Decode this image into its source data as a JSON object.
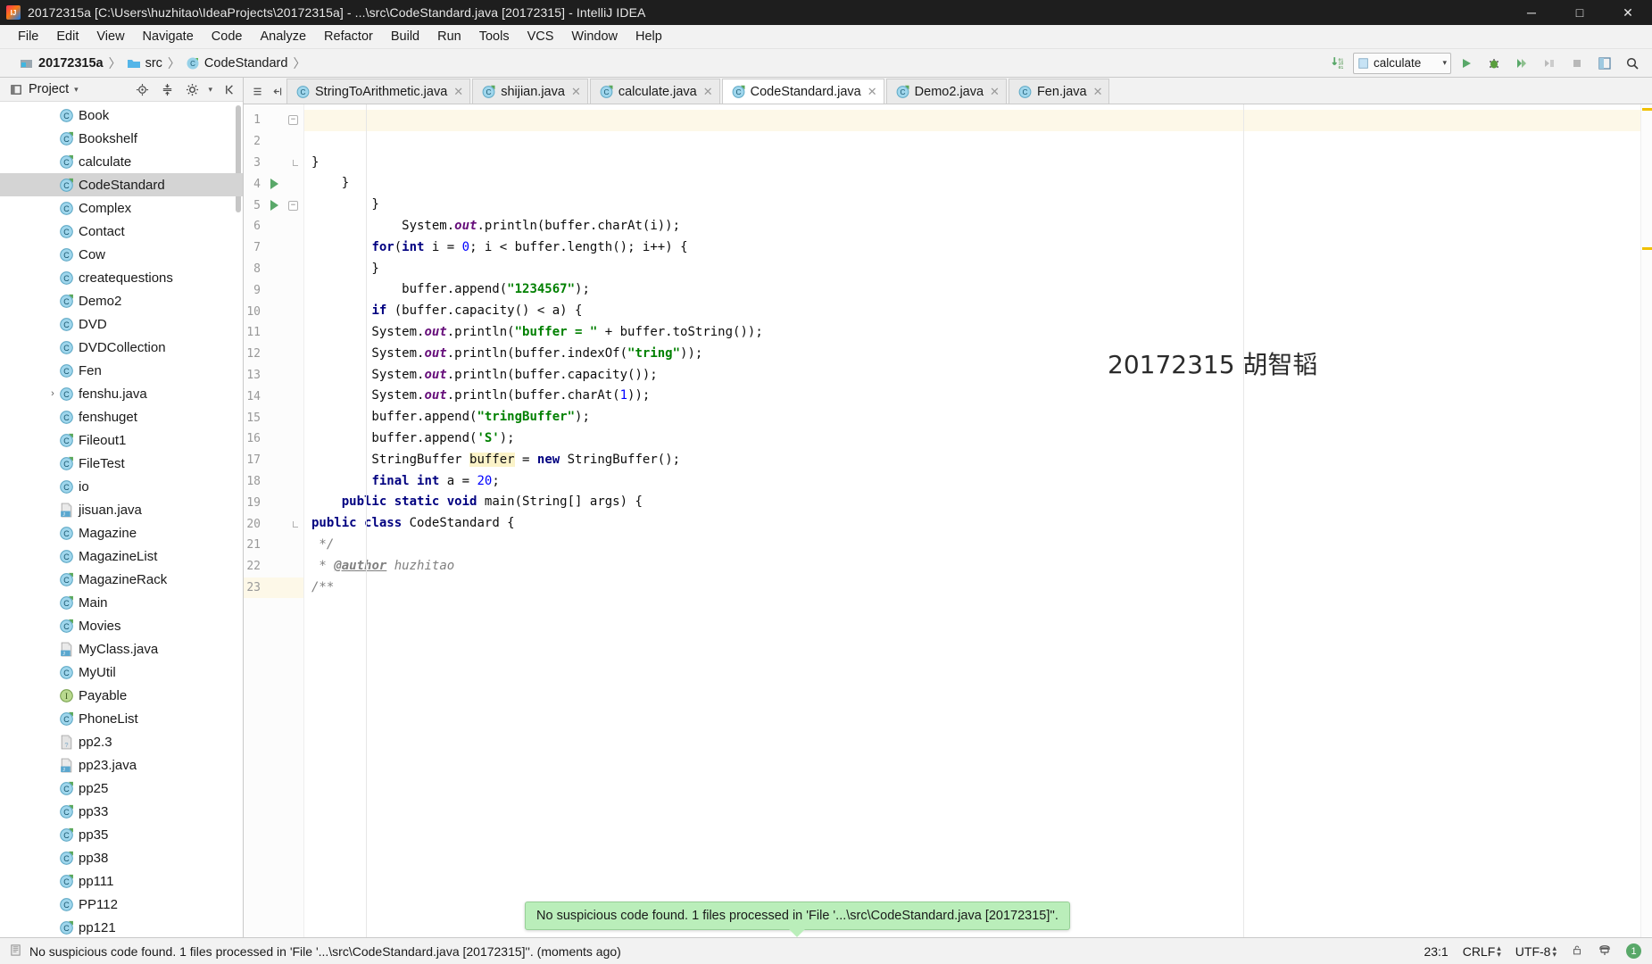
{
  "window": {
    "title": "20172315a [C:\\Users\\huzhitao\\IdeaProjects\\20172315a] - ...\\src\\CodeStandard.java [20172315] - IntelliJ IDEA",
    "logo_icon": "intellij-idea-logo-icon",
    "minimize_label": "─",
    "maximize_label": "□",
    "close_label": "✕"
  },
  "menubar": {
    "items": [
      {
        "label": "File"
      },
      {
        "label": "Edit"
      },
      {
        "label": "View"
      },
      {
        "label": "Navigate"
      },
      {
        "label": "Code"
      },
      {
        "label": "Analyze"
      },
      {
        "label": "Refactor"
      },
      {
        "label": "Build"
      },
      {
        "label": "Run"
      },
      {
        "label": "Tools"
      },
      {
        "label": "VCS"
      },
      {
        "label": "Window"
      },
      {
        "label": "Help"
      }
    ]
  },
  "navbar": {
    "crumbs": [
      {
        "label": "20172315a",
        "icon": "module-icon"
      },
      {
        "label": "src",
        "icon": "folder-icon"
      },
      {
        "label": "CodeStandard",
        "icon": "java-class-icon"
      }
    ],
    "separator": "〉",
    "update_icon": "download-updates-icon",
    "run_config": {
      "label": "calculate",
      "icon": "run-config-icon",
      "caret": "▾"
    },
    "buttons": [
      {
        "name": "run-button",
        "icon": "run-icon"
      },
      {
        "name": "debug-button",
        "icon": "debug-icon"
      },
      {
        "name": "run-coverage-button",
        "icon": "coverage-icon"
      },
      {
        "name": "attach-profiler-button",
        "icon": "profiler-icon"
      },
      {
        "name": "stop-button",
        "icon": "stop-icon"
      },
      {
        "name": "project-structure-button",
        "icon": "project-structure-icon"
      },
      {
        "name": "search-everywhere-button",
        "icon": "search-icon"
      }
    ]
  },
  "sidebar": {
    "title": "Project",
    "title_caret": "▾",
    "header_icons": [
      "project-view-icon",
      "locate-icon",
      "collapse-all-icon",
      "gear-icon",
      "hide-icon"
    ],
    "items": [
      {
        "label": "Book",
        "icon": "java-class-icon",
        "indent": 0,
        "arrow": "",
        "selected": false
      },
      {
        "label": "Bookshelf",
        "icon": "java-class-run-icon",
        "indent": 0,
        "arrow": "",
        "selected": false
      },
      {
        "label": "calculate",
        "icon": "java-class-run-icon",
        "indent": 0,
        "arrow": "",
        "selected": false
      },
      {
        "label": "CodeStandard",
        "icon": "java-class-run-icon",
        "indent": 0,
        "arrow": "",
        "selected": true
      },
      {
        "label": "Complex",
        "icon": "java-class-icon",
        "indent": 0,
        "arrow": "",
        "selected": false
      },
      {
        "label": "Contact",
        "icon": "java-class-icon",
        "indent": 0,
        "arrow": "",
        "selected": false
      },
      {
        "label": "Cow",
        "icon": "java-class-icon",
        "indent": 0,
        "arrow": "",
        "selected": false
      },
      {
        "label": "createquestions",
        "icon": "java-class-icon",
        "indent": 0,
        "arrow": "",
        "selected": false
      },
      {
        "label": "Demo2",
        "icon": "java-class-run-icon",
        "indent": 0,
        "arrow": "",
        "selected": false
      },
      {
        "label": "DVD",
        "icon": "java-class-icon",
        "indent": 0,
        "arrow": "",
        "selected": false
      },
      {
        "label": "DVDCollection",
        "icon": "java-class-icon",
        "indent": 0,
        "arrow": "",
        "selected": false
      },
      {
        "label": "Fen",
        "icon": "java-class-icon",
        "indent": 0,
        "arrow": "",
        "selected": false
      },
      {
        "label": "fenshu.java",
        "icon": "java-class-icon",
        "indent": 0,
        "arrow": "›",
        "selected": false
      },
      {
        "label": "fenshuget",
        "icon": "java-class-icon",
        "indent": 0,
        "arrow": "",
        "selected": false
      },
      {
        "label": "Fileout1",
        "icon": "java-class-run-icon",
        "indent": 0,
        "arrow": "",
        "selected": false
      },
      {
        "label": "FileTest",
        "icon": "java-class-run-icon",
        "indent": 0,
        "arrow": "",
        "selected": false
      },
      {
        "label": "io",
        "icon": "java-class-icon",
        "indent": 0,
        "arrow": "",
        "selected": false
      },
      {
        "label": "jisuan.java",
        "icon": "java-file-icon",
        "indent": 0,
        "arrow": "",
        "selected": false
      },
      {
        "label": "Magazine",
        "icon": "java-class-icon",
        "indent": 0,
        "arrow": "",
        "selected": false
      },
      {
        "label": "MagazineList",
        "icon": "java-class-icon",
        "indent": 0,
        "arrow": "",
        "selected": false
      },
      {
        "label": "MagazineRack",
        "icon": "java-class-run-icon",
        "indent": 0,
        "arrow": "",
        "selected": false
      },
      {
        "label": "Main",
        "icon": "java-class-run-icon",
        "indent": 0,
        "arrow": "",
        "selected": false
      },
      {
        "label": "Movies",
        "icon": "java-class-run-icon",
        "indent": 0,
        "arrow": "",
        "selected": false
      },
      {
        "label": "MyClass.java",
        "icon": "java-file-icon",
        "indent": 0,
        "arrow": "",
        "selected": false
      },
      {
        "label": "MyUtil",
        "icon": "java-class-icon",
        "indent": 0,
        "arrow": "",
        "selected": false
      },
      {
        "label": "Payable",
        "icon": "java-interface-icon",
        "indent": 0,
        "arrow": "",
        "selected": false
      },
      {
        "label": "PhoneList",
        "icon": "java-class-run-icon",
        "indent": 0,
        "arrow": "",
        "selected": false
      },
      {
        "label": "pp2.3",
        "icon": "unknown-file-icon",
        "indent": 0,
        "arrow": "",
        "selected": false
      },
      {
        "label": "pp23.java",
        "icon": "java-file-icon",
        "indent": 0,
        "arrow": "",
        "selected": false
      },
      {
        "label": "pp25",
        "icon": "java-class-run-icon",
        "indent": 0,
        "arrow": "",
        "selected": false
      },
      {
        "label": "pp33",
        "icon": "java-class-run-icon",
        "indent": 0,
        "arrow": "",
        "selected": false
      },
      {
        "label": "pp35",
        "icon": "java-class-run-icon",
        "indent": 0,
        "arrow": "",
        "selected": false
      },
      {
        "label": "pp38",
        "icon": "java-class-run-icon",
        "indent": 0,
        "arrow": "",
        "selected": false
      },
      {
        "label": "pp111",
        "icon": "java-class-run-icon",
        "indent": 0,
        "arrow": "",
        "selected": false
      },
      {
        "label": "PP112",
        "icon": "java-class-icon",
        "indent": 0,
        "arrow": "",
        "selected": false
      },
      {
        "label": "pp121",
        "icon": "java-class-run-icon",
        "indent": 0,
        "arrow": "",
        "selected": false
      }
    ]
  },
  "editor": {
    "tabs": [
      {
        "label": "StringToArithmetic.java",
        "icon": "java-class-icon",
        "close": "✕",
        "active": false
      },
      {
        "label": "shijian.java",
        "icon": "java-class-run-icon",
        "close": "✕",
        "active": false
      },
      {
        "label": "calculate.java",
        "icon": "java-class-run-icon",
        "close": "✕",
        "active": false
      },
      {
        "label": "CodeStandard.java",
        "icon": "java-class-run-icon",
        "close": "✕",
        "active": true
      },
      {
        "label": "Demo2.java",
        "icon": "java-class-run-icon",
        "close": "✕",
        "active": false
      },
      {
        "label": "Fen.java",
        "icon": "java-class-icon",
        "close": "✕",
        "active": false
      }
    ],
    "watermark": "20172315 胡智韬",
    "line_numbers": [
      "1",
      "2",
      "3",
      "4",
      "5",
      "6",
      "7",
      "8",
      "9",
      "10",
      "11",
      "12",
      "13",
      "14",
      "15",
      "16",
      "17",
      "18",
      "19",
      "20",
      "21",
      "22",
      "23"
    ],
    "caret_line": 23,
    "code_lines": [
      {
        "n": 1,
        "text": "/**"
      },
      {
        "n": 2,
        "text": " * @author huzhitao"
      },
      {
        "n": 3,
        "text": " */"
      },
      {
        "n": 4,
        "text": "public class CodeStandard {"
      },
      {
        "n": 5,
        "text": "    public static void main(String[] args) {"
      },
      {
        "n": 6,
        "text": "        final int a = 20;"
      },
      {
        "n": 7,
        "text": "        StringBuffer buffer = new StringBuffer();"
      },
      {
        "n": 8,
        "text": "        buffer.append('S');"
      },
      {
        "n": 9,
        "text": "        buffer.append(\"tringBuffer\");"
      },
      {
        "n": 10,
        "text": "        System.out.println(buffer.charAt(1));"
      },
      {
        "n": 11,
        "text": "        System.out.println(buffer.capacity());"
      },
      {
        "n": 12,
        "text": "        System.out.println(buffer.indexOf(\"tring\"));"
      },
      {
        "n": 13,
        "text": "        System.out.println(\"buffer = \" + buffer.toString());"
      },
      {
        "n": 14,
        "text": "        if (buffer.capacity() < a) {"
      },
      {
        "n": 15,
        "text": "            buffer.append(\"1234567\");"
      },
      {
        "n": 16,
        "text": "        }"
      },
      {
        "n": 17,
        "text": "        for(int i = 0; i < buffer.length(); i++) {"
      },
      {
        "n": 18,
        "text": "            System.out.println(buffer.charAt(i));"
      },
      {
        "n": 19,
        "text": "        }"
      },
      {
        "n": 20,
        "text": "    }"
      },
      {
        "n": 21,
        "text": "}"
      },
      {
        "n": 22,
        "text": ""
      },
      {
        "n": 23,
        "text": ""
      }
    ],
    "run_markers": [
      4,
      5
    ]
  },
  "notification": {
    "text": "No suspicious code found. 1 files processed in 'File '...\\src\\CodeStandard.java [20172315]''.",
    "background": "#baeeba"
  },
  "statusbar": {
    "icon": "event-log-icon",
    "message": "No suspicious code found. 1 files processed in 'File '...\\src\\CodeStandard.java [20172315]''. (moments ago)",
    "caret_position": "23:1",
    "line_separator": "CRLF",
    "encoding": "UTF-8",
    "stepper": "↕",
    "lock_icon": "read-only-lock-icon",
    "inspection_icon": "hector-inspection-icon",
    "badge_count": "1"
  },
  "colors": {
    "accent_green": "#59a869",
    "titlebar_bg": "#1e1e1e",
    "chrome_bg": "#f2f2f2",
    "editor_bg": "#ffffff",
    "selection_bg": "#d4d4d4",
    "caret_line_bg": "#fdf8e8",
    "notification_bg": "#baeeba"
  }
}
